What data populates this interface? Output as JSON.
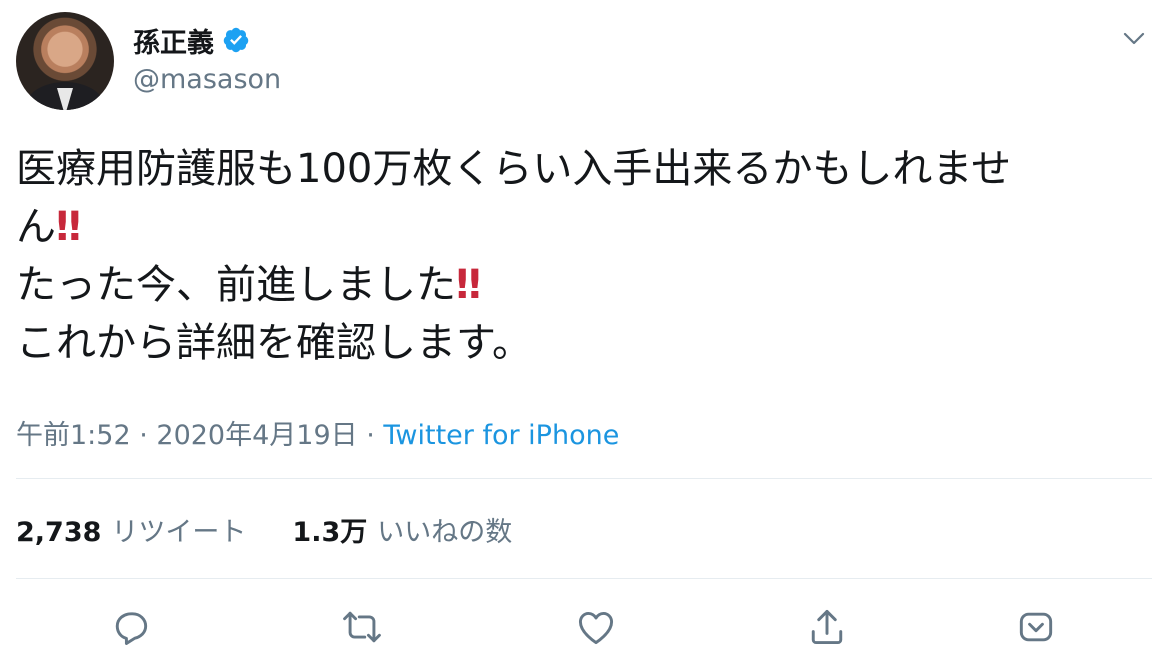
{
  "user": {
    "display_name": "孫正義",
    "handle": "@masason"
  },
  "tweet": {
    "line1": "医療用防護服も100万枚くらい入手出来るかもしれませ",
    "line2_text": "ん",
    "line2_emoji": "‼",
    "line3_text": "たった今、前進しました",
    "line3_emoji": "‼",
    "line4": "これから詳細を確認します。"
  },
  "meta": {
    "time": "午前1:52",
    "separator1": " · ",
    "date": "2020年4月19日",
    "separator2": " · ",
    "source": "Twitter for iPhone"
  },
  "stats": {
    "retweet_count": "2,738",
    "retweet_label": "リツイート",
    "like_count": "1.3万",
    "like_label": "いいねの数"
  },
  "colors": {
    "text": "#14171a",
    "secondary": "#657786",
    "link": "#1b95e0",
    "verified": "#1da1f2",
    "emoji": "#c7283b",
    "divider": "#e6ecf0"
  },
  "icons": {
    "verified": "verified-badge-icon",
    "caret": "chevron-down-icon",
    "reply": "reply-icon",
    "retweet": "retweet-icon",
    "like": "heart-icon",
    "share": "share-icon",
    "dm": "dm-icon"
  }
}
